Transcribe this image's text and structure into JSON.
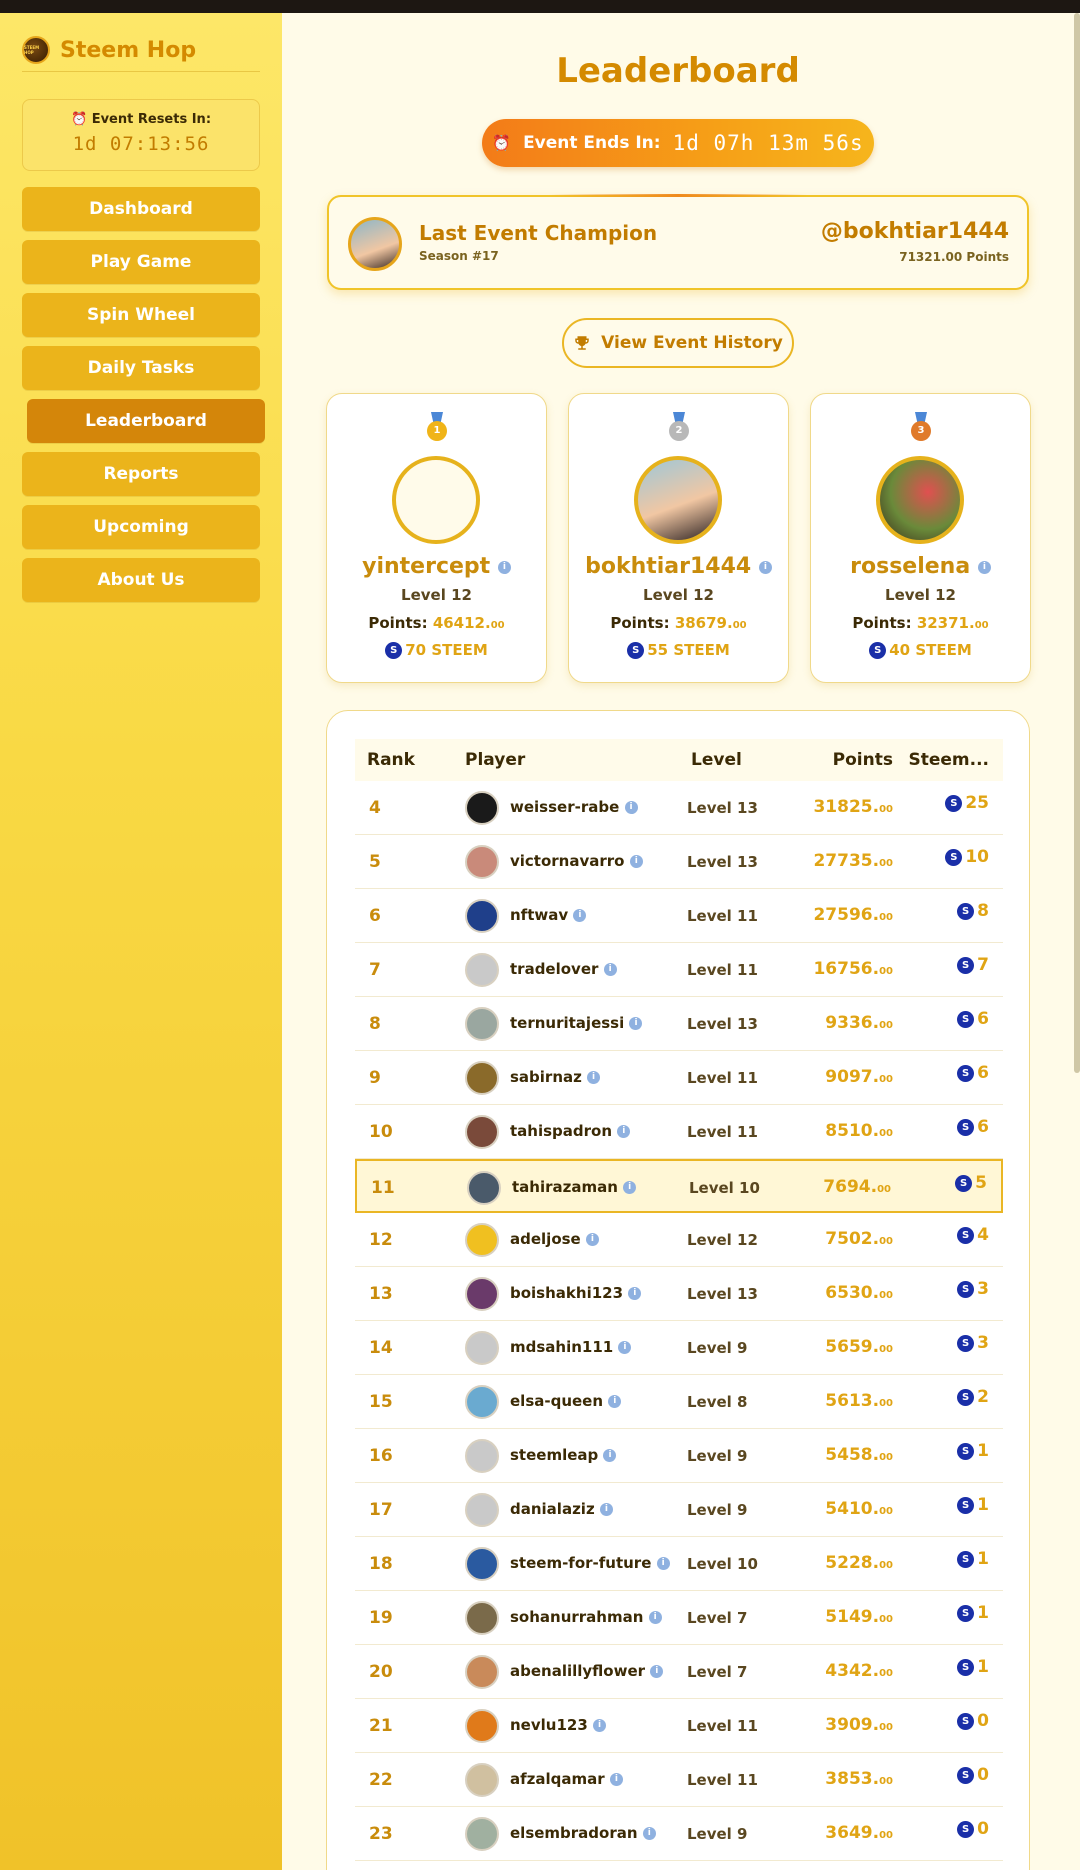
{
  "app": {
    "brand_name": "Steem Hop",
    "logo_text": "STEEM HOP"
  },
  "sidebar": {
    "reset_label": "⏰ Event Resets In:",
    "reset_time": "1d 07:13:56",
    "items": [
      {
        "label": "Dashboard",
        "active": false
      },
      {
        "label": "Play Game",
        "active": false
      },
      {
        "label": "Spin Wheel",
        "active": false
      },
      {
        "label": "Daily Tasks",
        "active": false
      },
      {
        "label": "Leaderboard",
        "active": true
      },
      {
        "label": "Reports",
        "active": false
      },
      {
        "label": "Upcoming",
        "active": false
      },
      {
        "label": "About Us",
        "active": false
      }
    ]
  },
  "header": {
    "title": "Leaderboard",
    "event_ends_label": "Event Ends In:",
    "event_ends_time": "1d 07h 13m 56s"
  },
  "champion": {
    "title": "Last Event Champion",
    "season": "Season #17",
    "name": "@bokhtiar1444",
    "points": "71321.00 Points"
  },
  "history_button": "View Event History",
  "podium": [
    {
      "place": "2",
      "name": "bokhtiar1444",
      "level": "Level 12",
      "points_label": "Points:",
      "points": "38679.",
      "points_dec": "00",
      "steem": "55 STEEM",
      "medal_color": "#b8b8b8"
    },
    {
      "place": "1",
      "name": "yintercept",
      "level": "Level 12",
      "points_label": "Points:",
      "points": "46412.",
      "points_dec": "00",
      "steem": "70 STEEM",
      "medal_color": "#f0b418"
    },
    {
      "place": "3",
      "name": "rosselena",
      "level": "Level 12",
      "points_label": "Points:",
      "points": "32371.",
      "points_dec": "00",
      "steem": "40 STEEM",
      "medal_color": "#e07a2a"
    }
  ],
  "table": {
    "headers": {
      "rank": "Rank",
      "player": "Player",
      "level": "Level",
      "points": "Points",
      "steem": "Steem..."
    },
    "rows": [
      {
        "rank": "4",
        "name": "weisser-rabe",
        "level": "Level 13",
        "points": "31825.",
        "dec": "00",
        "steem": "25",
        "av": "#1a1a1a"
      },
      {
        "rank": "5",
        "name": "victornavarro",
        "level": "Level 13",
        "points": "27735.",
        "dec": "00",
        "steem": "10",
        "av": "#c98a7a"
      },
      {
        "rank": "6",
        "name": "nftwav",
        "level": "Level 11",
        "points": "27596.",
        "dec": "00",
        "steem": "8",
        "av": "#1f3f8a"
      },
      {
        "rank": "7",
        "name": "tradelover",
        "level": "Level 11",
        "points": "16756.",
        "dec": "00",
        "steem": "7",
        "av": "#c9c9c9"
      },
      {
        "rank": "8",
        "name": "ternuritajessi",
        "level": "Level 13",
        "points": "9336.",
        "dec": "00",
        "steem": "6",
        "av": "#9aa7a0"
      },
      {
        "rank": "9",
        "name": "sabirnaz",
        "level": "Level 11",
        "points": "9097.",
        "dec": "00",
        "steem": "6",
        "av": "#8a6a2a"
      },
      {
        "rank": "10",
        "name": "tahispadron",
        "level": "Level 11",
        "points": "8510.",
        "dec": "00",
        "steem": "6",
        "av": "#7a4a3a"
      },
      {
        "rank": "11",
        "name": "tahirazaman",
        "level": "Level 10",
        "points": "7694.",
        "dec": "00",
        "steem": "5",
        "av": "#4a5a6a",
        "me": true
      },
      {
        "rank": "12",
        "name": "adeljose",
        "level": "Level 12",
        "points": "7502.",
        "dec": "00",
        "steem": "4",
        "av": "#f0c020"
      },
      {
        "rank": "13",
        "name": "boishakhi123",
        "level": "Level 13",
        "points": "6530.",
        "dec": "00",
        "steem": "3",
        "av": "#6a3a6a"
      },
      {
        "rank": "14",
        "name": "mdsahin111",
        "level": "Level 9",
        "points": "5659.",
        "dec": "00",
        "steem": "3",
        "av": "#c9c9c9"
      },
      {
        "rank": "15",
        "name": "elsa-queen",
        "level": "Level 8",
        "points": "5613.",
        "dec": "00",
        "steem": "2",
        "av": "#6aaad0"
      },
      {
        "rank": "16",
        "name": "steemleap",
        "level": "Level 9",
        "points": "5458.",
        "dec": "00",
        "steem": "1",
        "av": "#c9c9c9"
      },
      {
        "rank": "17",
        "name": "danialaziz",
        "level": "Level 9",
        "points": "5410.",
        "dec": "00",
        "steem": "1",
        "av": "#c9c9c9"
      },
      {
        "rank": "18",
        "name": "steem-for-future",
        "level": "Level 10",
        "points": "5228.",
        "dec": "00",
        "steem": "1",
        "av": "#2a5aa0"
      },
      {
        "rank": "19",
        "name": "sohanurrahman",
        "level": "Level 7",
        "points": "5149.",
        "dec": "00",
        "steem": "1",
        "av": "#7a6a4a"
      },
      {
        "rank": "20",
        "name": "abenalillyflower",
        "level": "Level 7",
        "points": "4342.",
        "dec": "00",
        "steem": "1",
        "av": "#c98a5a"
      },
      {
        "rank": "21",
        "name": "nevlu123",
        "level": "Level 11",
        "points": "3909.",
        "dec": "00",
        "steem": "0",
        "av": "#e07a1a"
      },
      {
        "rank": "22",
        "name": "afzalqamar",
        "level": "Level 11",
        "points": "3853.",
        "dec": "00",
        "steem": "0",
        "av": "#d0c0a0"
      },
      {
        "rank": "23",
        "name": "elsembradoran",
        "level": "Level 9",
        "points": "3649.",
        "dec": "00",
        "steem": "0",
        "av": "#a0b0a0"
      }
    ]
  },
  "colors": {
    "accent": "#d48a00",
    "gold": "#e0a414",
    "steem_blue": "#1a2fa8",
    "nav_button": "#ebb41b",
    "nav_active": "#d4860a"
  }
}
